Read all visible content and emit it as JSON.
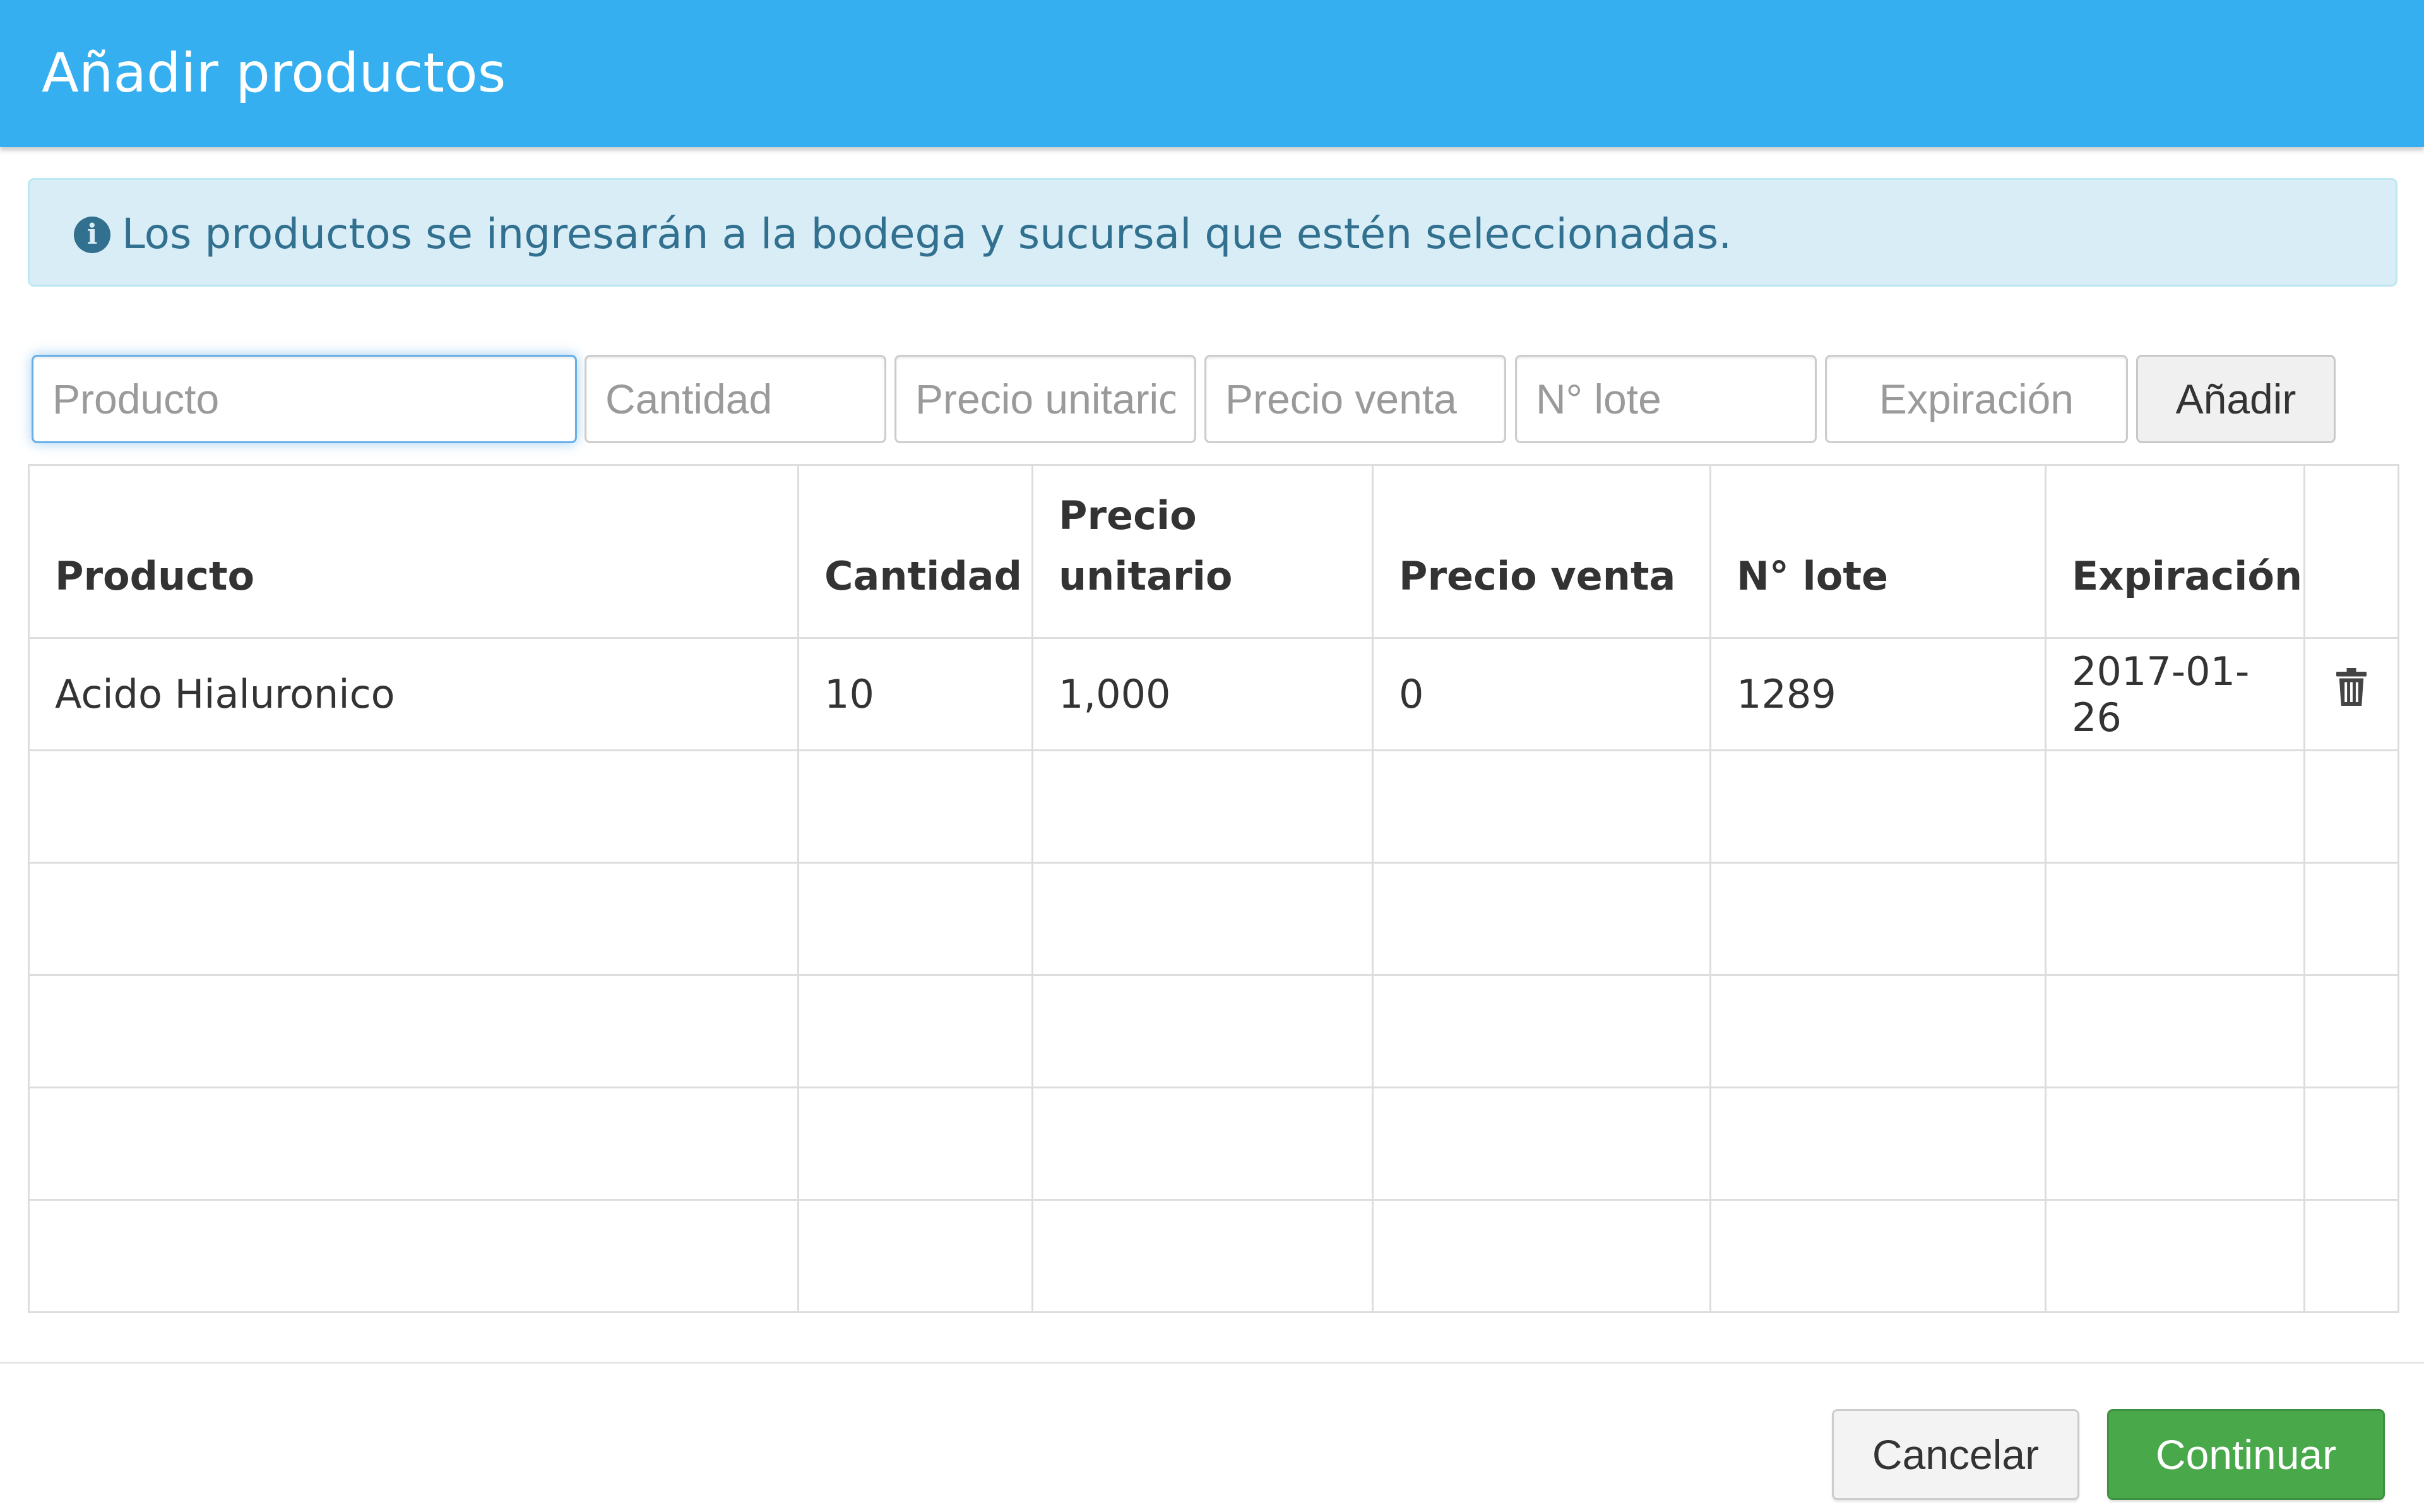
{
  "modal": {
    "title": "Añadir productos"
  },
  "alert": {
    "icon": "info-icon",
    "icon_glyph": "i",
    "text": "Los productos se ingresarán a la bodega y sucursal que estén seleccionadas."
  },
  "inputs": {
    "product": {
      "placeholder": "Producto",
      "value": ""
    },
    "quantity": {
      "placeholder": "Cantidad",
      "value": ""
    },
    "unit_price": {
      "placeholder": "Precio unitario",
      "value": ""
    },
    "sale_price": {
      "placeholder": "Precio venta",
      "value": ""
    },
    "lot": {
      "placeholder": "N° lote",
      "value": ""
    },
    "expiration": {
      "placeholder": "Expiración",
      "value": ""
    },
    "add_label": "Añadir"
  },
  "table": {
    "headers": {
      "product": "Producto",
      "quantity": "Cantidad",
      "unit_price_line1": "Precio",
      "unit_price_line2": "unitario",
      "sale_price": "Precio venta",
      "lot": "N° lote",
      "expiration": "Expiración"
    },
    "rows": [
      {
        "product": "Acido Hialuronico",
        "quantity": "10",
        "unit_price": "1,000",
        "sale_price": "0",
        "lot": "1289",
        "expiration": "2017-01-26",
        "action_icon": "trash-icon"
      }
    ]
  },
  "footer": {
    "cancel_label": "Cancelar",
    "continue_label": "Continuar"
  },
  "colors": {
    "header": "#35aff0",
    "alert_bg": "#d9edf7",
    "alert_text": "#31708f",
    "continue": "#49a94a"
  }
}
